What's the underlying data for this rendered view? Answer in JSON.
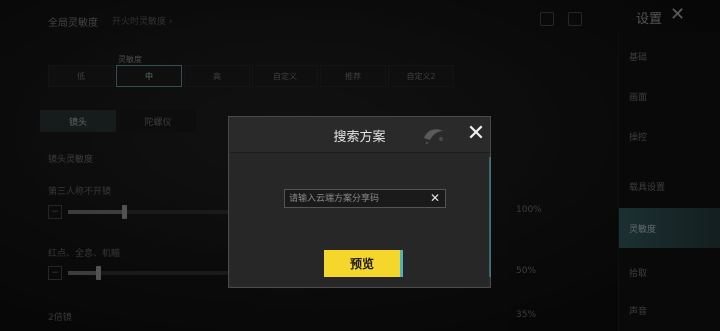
{
  "background": {
    "header_title": "全局灵敏度",
    "header_path": "开火时灵敏度 ›",
    "panel_title": "设置",
    "close_glyph": "✕",
    "sens_tag": "灵敏度",
    "presets": [
      "低",
      "中",
      "高",
      "自定义",
      "推荐",
      "自定义2"
    ],
    "tabs": [
      "镜头",
      "陀螺仪"
    ],
    "section_label": "镜头灵敏度",
    "rows": [
      {
        "label": "第三人称不开镜",
        "value": "100%"
      },
      {
        "label": "红点、全息、机瞄",
        "value": "50%"
      },
      {
        "label": "2倍镜",
        "value": "35%"
      }
    ],
    "sidebar_items": [
      "基础",
      "画面",
      "操控",
      "载具设置",
      "灵敏度",
      "拾取",
      "声音"
    ],
    "sidebar_active_index": 4
  },
  "modal": {
    "title": "搜索方案",
    "close_glyph": "✕",
    "input": {
      "placeholder": "请输入云端方案分享码",
      "value": "",
      "clear_glyph": "✕"
    },
    "preview_button": "预览"
  },
  "colors": {
    "accent_yellow": "#f5d62a",
    "accent_teal": "#4fb3bf"
  }
}
